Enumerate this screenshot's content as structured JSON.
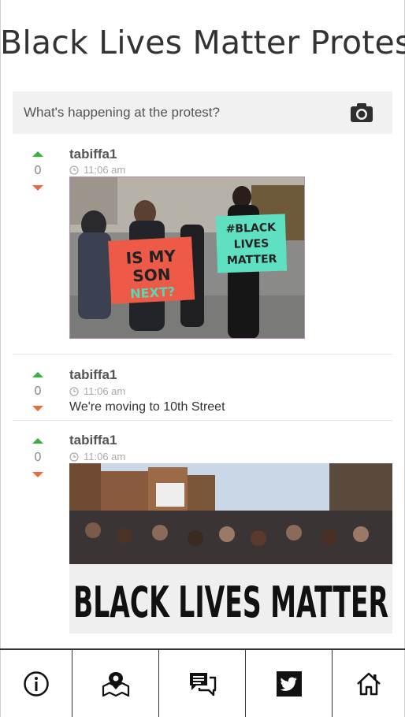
{
  "header": {
    "title": "Black Lives Matter Protest"
  },
  "composer": {
    "placeholder": "What's happening at the protest?",
    "icon": "camera-icon"
  },
  "posts": [
    {
      "author": "tabiffa1",
      "time": "11:06 am",
      "votes": "0",
      "type": "photo",
      "image_text": {
        "sign_left": "IS MY SON NEXT?",
        "sign_right": "#BLACK LIVES MATTER"
      }
    },
    {
      "author": "tabiffa1",
      "time": "11:06 am",
      "votes": "0",
      "type": "text",
      "message": "We're moving to 10th Street"
    },
    {
      "author": "tabiffa1",
      "time": "11:06 am",
      "votes": "0",
      "type": "photo",
      "image_text": {
        "banner": "BLACK LIVES MATTER"
      }
    }
  ],
  "tabbar": {
    "items": [
      "info-icon",
      "map-pin-icon",
      "chat-icon",
      "twitter-icon",
      "home-icon"
    ]
  },
  "colors": {
    "upvote": "#34b334",
    "downvote": "#f0693a",
    "composer_bg": "#f1f1f1"
  }
}
